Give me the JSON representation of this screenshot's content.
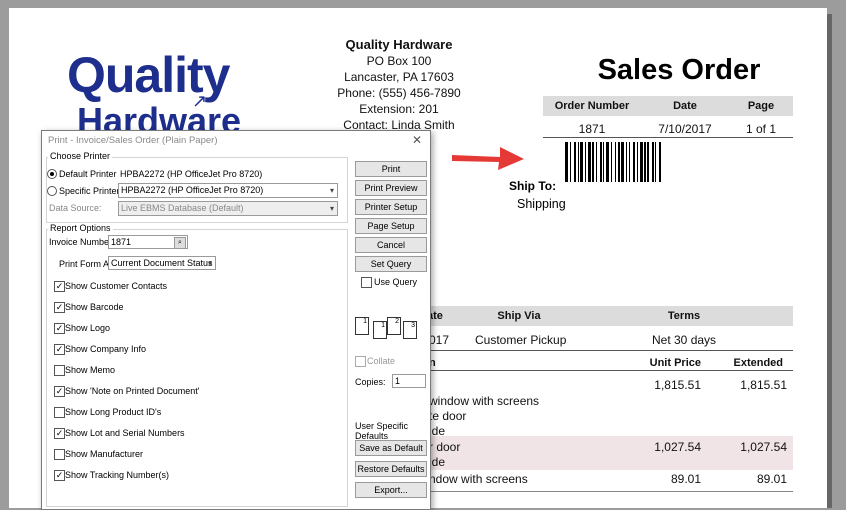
{
  "logo": {
    "line1": "Quality",
    "line2": "Hardware"
  },
  "company": {
    "name": "Quality Hardware",
    "address1": "PO Box 100",
    "address2": "Lancaster, PA 17603",
    "phone": "Phone:  (555) 456-7890",
    "extension": "Extension:  201",
    "contact": "Contact:  Linda Smith"
  },
  "sales_order": {
    "title": "Sales Order",
    "headers": [
      "Order Number",
      "Date",
      "Page"
    ],
    "values": [
      "1871",
      "7/10/2017",
      "1 of 1"
    ]
  },
  "ship_to": {
    "label": "Ship To:",
    "value": "Shipping"
  },
  "terms_table": {
    "headers": [
      "ate",
      "Ship Via",
      "Terms"
    ],
    "values": [
      "017",
      "Customer Pickup",
      "Net 30  days"
    ]
  },
  "items_table": {
    "headers": [
      "n",
      "Unit Price",
      "Extended"
    ],
    "rows": [
      {
        "desc": [
          "",
          "window with screens",
          "te door",
          "ide"
        ],
        "unit": "1,815.51",
        "ext": "1,815.51"
      },
      {
        "desc": [
          "r door",
          "ide"
        ],
        "unit": "1,027.54",
        "ext": "1,027.54"
      },
      {
        "desc": [
          "ndow with screens"
        ],
        "unit": "89.01",
        "ext": "89.01"
      }
    ]
  },
  "dialog": {
    "title": "Print - Invoice/Sales Order (Plain Paper)",
    "close": "✕",
    "choose_printer": "Choose Printer",
    "default_printer_label": "Default Printer",
    "default_printer_value": "HPBA2272 (HP OfficeJet Pro 8720)",
    "specific_printer_label": "Specific Printer",
    "specific_printer_value": "HPBA2272 (HP OfficeJet Pro 8720)",
    "data_source_label": "Data Source:",
    "data_source_value": "Live EBMS Database (Default)",
    "report_options": "Report Options",
    "invoice_number_label": "Invoice Number:",
    "invoice_number_value": "1871",
    "print_form_as_label": "Print Form As:",
    "print_form_as_value": "Current Document Status",
    "checkboxes": [
      {
        "label": "Show Customer Contacts",
        "checked": true
      },
      {
        "label": "Show Barcode",
        "checked": true
      },
      {
        "label": "Show Logo",
        "checked": true
      },
      {
        "label": "Show Company Info",
        "checked": true
      },
      {
        "label": "Show Memo",
        "checked": false
      },
      {
        "label": "Show 'Note on Printed Document'",
        "checked": true
      },
      {
        "label": "Show Long Product ID's",
        "checked": false
      },
      {
        "label": "Show Lot and Serial Numbers",
        "checked": true
      },
      {
        "label": "Show Manufacturer",
        "checked": false
      },
      {
        "label": "Show Tracking Number(s)",
        "checked": true
      }
    ],
    "buttons": {
      "print": "Print",
      "print_preview": "Print Preview",
      "printer_setup": "Printer Setup",
      "page_setup": "Page Setup",
      "cancel": "Cancel",
      "set_query": "Set Query",
      "save_default": "Save as Default",
      "restore_defaults": "Restore Defaults",
      "export": "Export..."
    },
    "use_query": "Use Query",
    "collate": "Collate",
    "copies_label": "Copies:",
    "copies_value": "1",
    "user_specific": "User Specific Defaults",
    "copy_icons": [
      "1",
      "1",
      "2",
      "3"
    ]
  },
  "colors": {
    "arrow": "#e53935",
    "logo": "#1d2e8c",
    "row_highlight": "#f0e4e6"
  }
}
